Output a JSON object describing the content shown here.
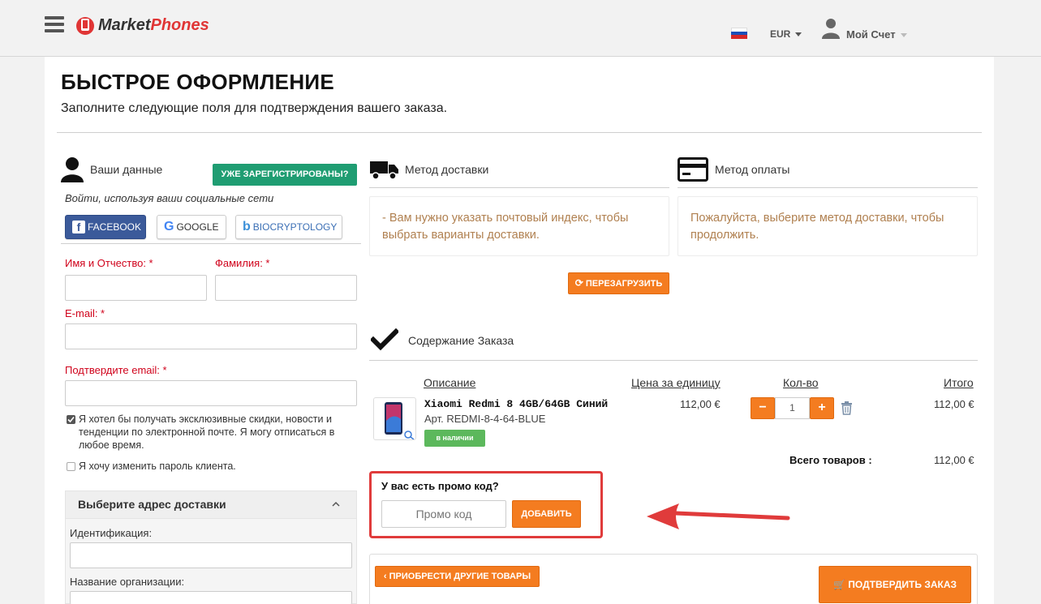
{
  "header": {
    "logo_part1": "Market",
    "logo_part2": "Phones",
    "currency": "EUR",
    "account": "Мой Счет"
  },
  "page": {
    "title": "БЫСТРОЕ ОФОРМЛЕНИЕ",
    "subtitle": "Заполните следующие поля для подтверждения вашего заказа."
  },
  "customer": {
    "title": "Ваши данные",
    "registered_button": "УЖЕ ЗАРЕГИСТРИРОВАНЫ?",
    "social_note": "Войти, используя ваши социальные сети",
    "social": [
      "FACEBOOK",
      "GOOGLE",
      "BIOCRYPTOLOGY"
    ],
    "first_name_label": "Имя и Отчество: *",
    "last_name_label": "Фамилия: *",
    "email_label": "E-mail: *",
    "confirm_email_label": "Подтвердите email: *",
    "newsletter_text": "Я хотел бы получать эксклюзивные скидки, новости и тенденции по электронной почте. Я могу отписаться в любое время.",
    "change_password_text": "Я хочу изменить пароль клиента."
  },
  "address": {
    "title": "Выберите адрес доставки",
    "id_label": "Идентификация:",
    "org_label": "Название организации:"
  },
  "delivery": {
    "title": "Метод доставки",
    "notice": "- Вам нужно указать почтовый индекс, чтобы выбрать варианты доставки.",
    "reload_button": "ПЕРЕЗАГРУЗИТЬ"
  },
  "payment": {
    "title": "Метод оплаты",
    "notice": "Пожалуйста, выберите метод доставки, чтобы продолжить."
  },
  "order": {
    "title": "Содержание Заказа",
    "headers": {
      "description": "Описание",
      "unit_price": "Цена за единицу",
      "qty": "Кол-во",
      "total": "Итого"
    },
    "item": {
      "name": "Xiaomi Redmi 8 4GB/64GB Синий",
      "sku": "Арт. REDMI-8-4-64-BLUE",
      "stock": "в наличии",
      "price": "112,00 €",
      "qty": "1",
      "total": "112,00 €"
    },
    "total_label": "Всего товаров :",
    "total_value": "112,00 €"
  },
  "promo": {
    "title": "У вас есть промо код?",
    "placeholder": "Промо код",
    "add_button": "ДОБАВИТЬ"
  },
  "footer": {
    "continue_button": "ПРИОБРЕСТИ ДРУГИЕ ТОВАРЫ",
    "confirm_button": "ПОДТВЕРДИТЬ ЗАКАЗ"
  },
  "colors": {
    "accent_orange": "#f47c20",
    "green": "#1f9d72",
    "facebook": "#3b5a9a",
    "highlight_red": "#e03b3b"
  }
}
